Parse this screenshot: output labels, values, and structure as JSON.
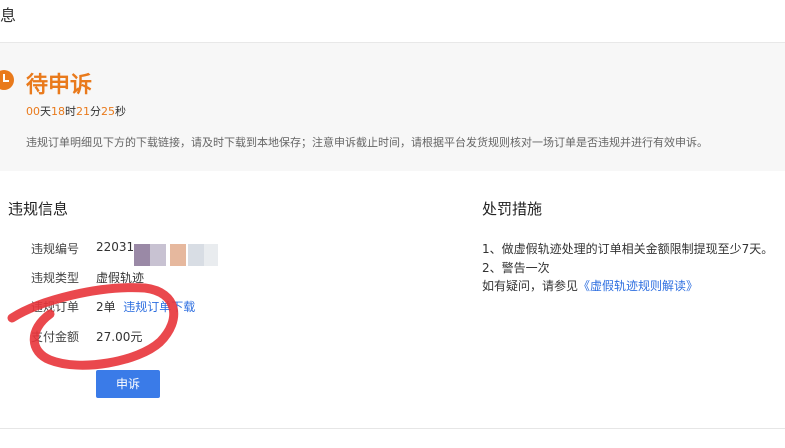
{
  "header": {
    "title_fragment": "息"
  },
  "status": {
    "title": "待申诉",
    "countdown": {
      "days": "00",
      "days_unit": "天",
      "hours": "18",
      "hours_unit": "时",
      "minutes": "21",
      "minutes_unit": "分",
      "seconds": "25",
      "seconds_unit": "秒"
    },
    "notice": "违规订单明细见下方的下载链接，请及时下载到本地保存；注意申诉截止时间，请根据平台发货规则核对一场订单是否违规并进行有效申诉。",
    "accent_color": "#e97a1c"
  },
  "violation_info": {
    "section_title": "违规信息",
    "fields": {
      "number_label": "违规编号",
      "number_value": "22031",
      "type_label": "违规类型",
      "type_value": "虚假轨迹",
      "orders_label": "违规订单",
      "orders_count": "2单",
      "orders_link": "违规订单下载",
      "amount_label": "支付金额",
      "amount_value": "27.00元"
    },
    "appeal_button": "申诉"
  },
  "penalty": {
    "section_title": "处罚措施",
    "line1": "1、做虚假轨迹处理的订单相关金额限制提现至少7天。",
    "line2": "2、警告一次",
    "help_prefix": "如有疑问，请参见",
    "help_link": "《虚假轨迹规则解读》"
  },
  "colors": {
    "link": "#2e6fe0",
    "button": "#3a7be8",
    "annotation": "#e8343a"
  }
}
